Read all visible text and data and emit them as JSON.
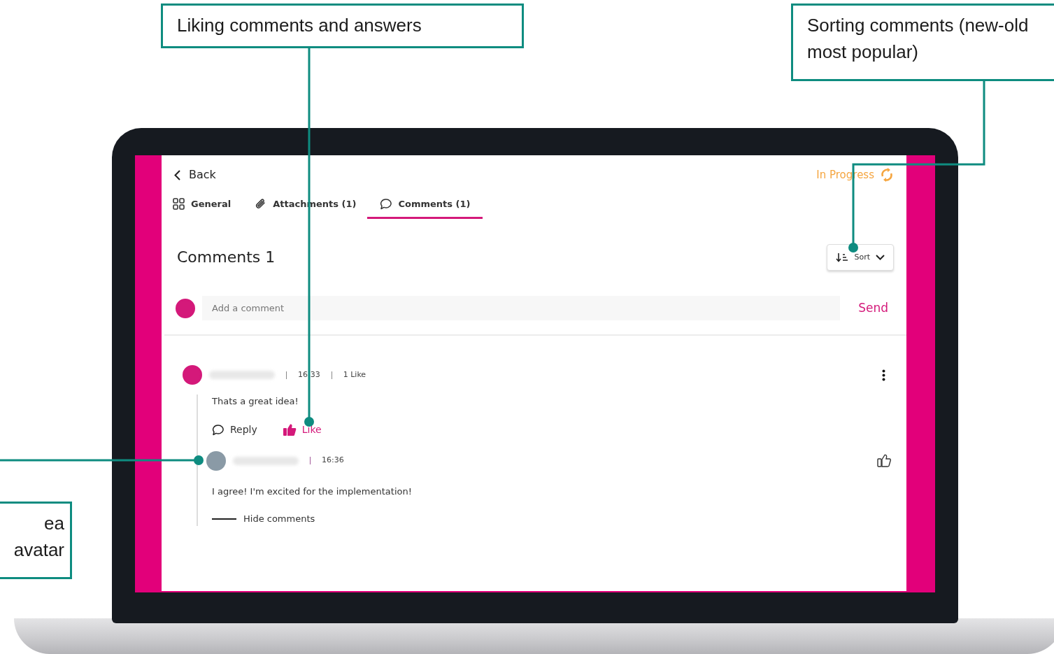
{
  "callouts": [
    {
      "lines": [
        "Liking comments and answers"
      ]
    },
    {
      "lines": [
        "Sorting comments (new-old",
        "most popular)"
      ]
    },
    {
      "lines": [
        "ea",
        "avatar"
      ]
    }
  ],
  "app": {
    "back": "Back",
    "status": "In Progress",
    "tabs": [
      {
        "label": "General",
        "selected": false
      },
      {
        "label": "Attachments (1)",
        "selected": false
      },
      {
        "label": "Comments (1)",
        "selected": true
      }
    ],
    "heading": "Comments 1",
    "sort": "Sort",
    "composer": {
      "placeholder": "Add a comment",
      "send": "Send"
    },
    "comments": [
      {
        "time": "16:33",
        "likes": "1 Like",
        "text": "Thats a great idea!",
        "reply_label": "Reply",
        "like_label": "Like",
        "liked": true,
        "hide_label": "Hide comments",
        "replies": [
          {
            "time": "16:36",
            "text": "I agree! I'm excited for the implementation!",
            "liked": false
          }
        ]
      }
    ]
  }
}
